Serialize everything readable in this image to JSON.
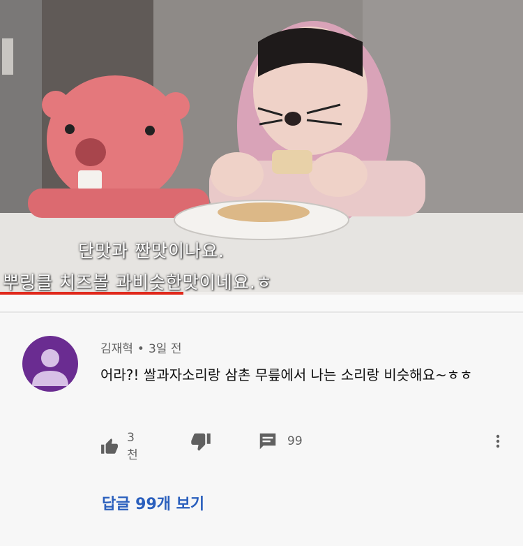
{
  "video": {
    "caption_line1": "단맛과 짠맛이나요.",
    "caption_line2": "뿌링클 치즈볼 과비슷한맛이네요.ㅎ",
    "progress_percent": 35
  },
  "comment": {
    "author": "김재혁",
    "separator": "•",
    "time": "3일 전",
    "text": "어라?! 쌀과자소리랑 삼촌 무릎에서 나는 소리랑 비슷해요~ㅎㅎ",
    "likes": "3천",
    "reply_count": "99",
    "view_replies": "답글 99개 보기"
  },
  "icons": {
    "like": "thumbs-up-icon",
    "dislike": "thumbs-down-icon",
    "reply": "reply-icon",
    "more": "more-vertical-icon",
    "avatar": "default-avatar"
  },
  "colors": {
    "progress": "#e0291c",
    "link": "#2a5fbd",
    "avatar_bg": "#6a2c91"
  }
}
